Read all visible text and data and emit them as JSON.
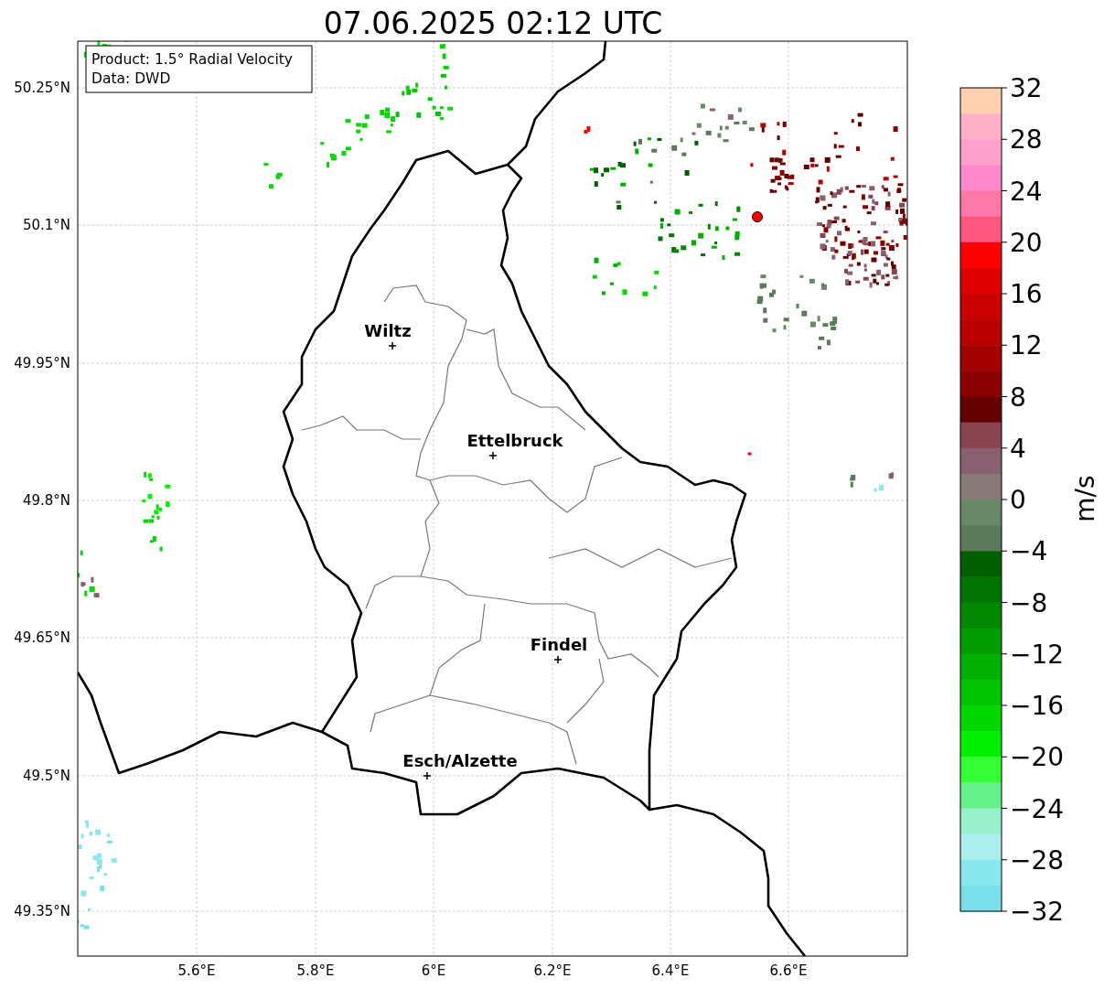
{
  "title": "07.06.2025 02:12 UTC",
  "info_box": [
    "Product: 1.5° Radial Velocity",
    "Data: DWD"
  ],
  "lat_ticks": [
    "50.25°N",
    "50.1°N",
    "49.95°N",
    "49.8°N",
    "49.65°N",
    "49.5°N",
    "49.35°N"
  ],
  "lon_ticks": [
    "5.6°E",
    "5.8°E",
    "6°E",
    "6.2°E",
    "6.4°E",
    "6.6°E"
  ],
  "cities": [
    {
      "name": "Wiltz"
    },
    {
      "name": "Ettelbruck"
    },
    {
      "name": "Findel"
    },
    {
      "name": "Esch/Alzette"
    }
  ],
  "colorbar": {
    "label": "m/s",
    "ticks": [
      "32",
      "28",
      "24",
      "20",
      "16",
      "12",
      "8",
      "4",
      "0",
      "−4",
      "−8",
      "−12",
      "−16",
      "−20",
      "−24",
      "−28",
      "−32"
    ],
    "bands": [
      {
        "color": "#ffd0b0"
      },
      {
        "color": "#ffb0c8"
      },
      {
        "color": "#ffa0cc"
      },
      {
        "color": "#ff88cc"
      },
      {
        "color": "#ff78a8"
      },
      {
        "color": "#ff5880"
      },
      {
        "color": "#ff0000"
      },
      {
        "color": "#e00000"
      },
      {
        "color": "#cc0000"
      },
      {
        "color": "#bb0000"
      },
      {
        "color": "#a50000"
      },
      {
        "color": "#8b0000"
      },
      {
        "color": "#660000"
      },
      {
        "color": "#884450"
      },
      {
        "color": "#886070"
      },
      {
        "color": "#887a78"
      },
      {
        "color": "#688868"
      },
      {
        "color": "#5a7a5a"
      },
      {
        "color": "#006000"
      },
      {
        "color": "#007400"
      },
      {
        "color": "#008800"
      },
      {
        "color": "#009c00"
      },
      {
        "color": "#00b000"
      },
      {
        "color": "#00c400"
      },
      {
        "color": "#00d800"
      },
      {
        "color": "#00f000"
      },
      {
        "color": "#33ff33"
      },
      {
        "color": "#66f088"
      },
      {
        "color": "#99f0cc"
      },
      {
        "color": "#aaeeee"
      },
      {
        "color": "#88e8ee"
      },
      {
        "color": "#77e0e8"
      }
    ]
  }
}
